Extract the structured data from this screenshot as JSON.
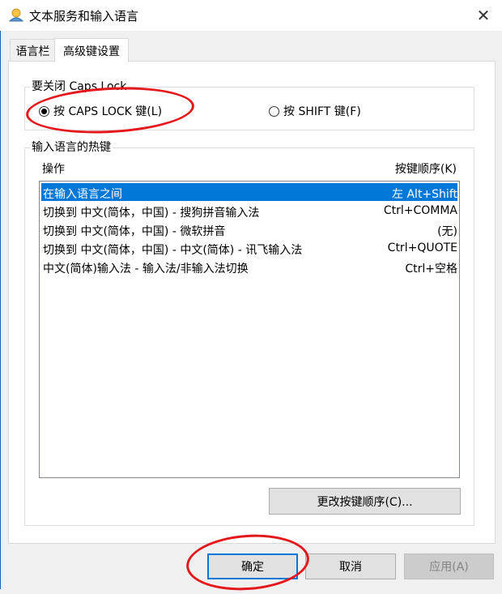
{
  "window": {
    "title": "文本服务和输入语言",
    "close_symbol": "✕"
  },
  "tabs": [
    {
      "label": "语言栏",
      "active": false
    },
    {
      "label": "高级键设置",
      "active": true
    }
  ],
  "caps_lock_group": {
    "title": "要关闭 Caps Lock",
    "options": [
      {
        "label": "按 CAPS LOCK 键(L)",
        "checked": true
      },
      {
        "label": "按 SHIFT 键(F)",
        "checked": false
      }
    ]
  },
  "hotkeys_group": {
    "title": "输入语言的热键",
    "column_action": "操作",
    "column_key": "按键顺序(K)",
    "rows": [
      {
        "action": "在输入语言之间",
        "key": "左 Alt+Shift",
        "selected": true
      },
      {
        "action": "切换到 中文(简体，中国) - 搜狗拼音输入法",
        "key": "Ctrl+COMMA",
        "selected": false
      },
      {
        "action": "切换到 中文(简体，中国) - 微软拼音",
        "key": "(无)",
        "selected": false
      },
      {
        "action": "切换到 中文(简体，中国) - 中文(简体) - 讯飞输入法",
        "key": "Ctrl+QUOTE",
        "selected": false
      },
      {
        "action": "中文(简体)输入法 - 输入法/非输入法切换",
        "key": "Ctrl+空格",
        "selected": false
      }
    ],
    "change_button": "更改按键顺序(C)..."
  },
  "footer": {
    "ok": "确定",
    "cancel": "取消",
    "apply": "应用(A)"
  },
  "colors": {
    "accent": "#0078d7",
    "annotation": "#e4171b"
  }
}
